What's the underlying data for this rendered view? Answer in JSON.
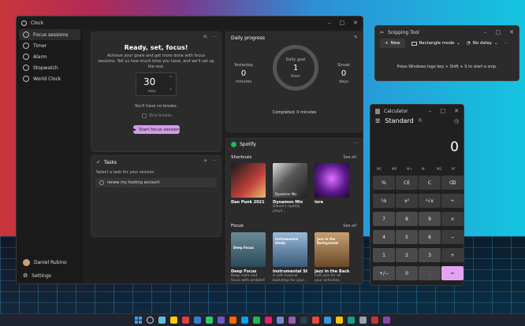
{
  "clock": {
    "title": "Clock",
    "nav": [
      {
        "label": "Focus sessions",
        "icon": "focus-icon"
      },
      {
        "label": "Timer",
        "icon": "timer-icon"
      },
      {
        "label": "Alarm",
        "icon": "alarm-icon"
      },
      {
        "label": "Stopwatch",
        "icon": "stopwatch-icon"
      },
      {
        "label": "World Clock",
        "icon": "world-clock-icon"
      }
    ],
    "user_name": "Daniel Rubino",
    "settings_label": "Settings",
    "focus": {
      "title": "Ready, set, focus!",
      "desc": "Achieve your goals and get more done with focus sessions. Tell us how much time you have, and we'll set up the rest.",
      "minutes_value": "30",
      "minutes_unit": "mins",
      "breaks_text": "You'll have no breaks.",
      "skip_breaks": "Skip breaks",
      "start_button": "Start focus session"
    },
    "tasks": {
      "title": "Tasks",
      "subtitle": "Select a task for your session",
      "items": [
        "renew my hosting account"
      ]
    },
    "progress": {
      "title": "Daily progress",
      "yesterday_label": "Yesterday",
      "yesterday_value": "0",
      "yesterday_unit": "minutes",
      "goal_label": "Daily goal",
      "goal_value": "1",
      "goal_unit": "hour",
      "streak_label": "Streak",
      "streak_value": "0",
      "streak_unit": "days",
      "completed": "Completed: 0 minutes"
    },
    "spotify": {
      "title": "Spotify",
      "shortcuts_label": "Shortcuts",
      "focus_label": "Focus",
      "see_all": "See all",
      "shortcuts": [
        {
          "title": "Dan Punk 2021",
          "sub": "",
          "color": "#c0403a"
        },
        {
          "title": "Dynamon Mix",
          "sub": "Daniel's spotify playli...",
          "color": "#6a5a5a",
          "art_label": "Dynamon Mix"
        },
        {
          "title": "lore",
          "sub": "",
          "color": "#7a2a9a"
        }
      ],
      "focus": [
        {
          "title": "Deep Focus",
          "sub": "Keep calm and focus with ambient and...",
          "color": "#3a5a6a",
          "art_label": "Deep Focus"
        },
        {
          "title": "Instrumental Study",
          "sub": "A soft musical backdrop for your...",
          "color": "#4a6a8a",
          "art_label": "Instrumental Study"
        },
        {
          "title": "Jazz in the Backg...",
          "sub": "Soft jazz for all your activities.",
          "color": "#8a6a4a",
          "art_label": "Jazz in the Background"
        }
      ]
    }
  },
  "snipping": {
    "title": "Snipping Tool",
    "new_label": "New",
    "mode_label": "Rectangle mode",
    "delay_label": "No delay",
    "hint": "Press Windows logo key + Shift + S to start a snip."
  },
  "calculator": {
    "title": "Calculator",
    "mode": "Standard",
    "display": "0",
    "memory": [
      "MC",
      "MR",
      "M+",
      "M-",
      "MS",
      "M˅"
    ],
    "keys": [
      [
        "%",
        "CE",
        "C",
        "⌫"
      ],
      [
        "⅟x",
        "x²",
        "²√x",
        "÷"
      ],
      [
        "7",
        "8",
        "9",
        "×"
      ],
      [
        "4",
        "5",
        "6",
        "−"
      ],
      [
        "1",
        "2",
        "3",
        "+"
      ],
      [
        "+/−",
        "0",
        ".",
        "="
      ]
    ]
  }
}
